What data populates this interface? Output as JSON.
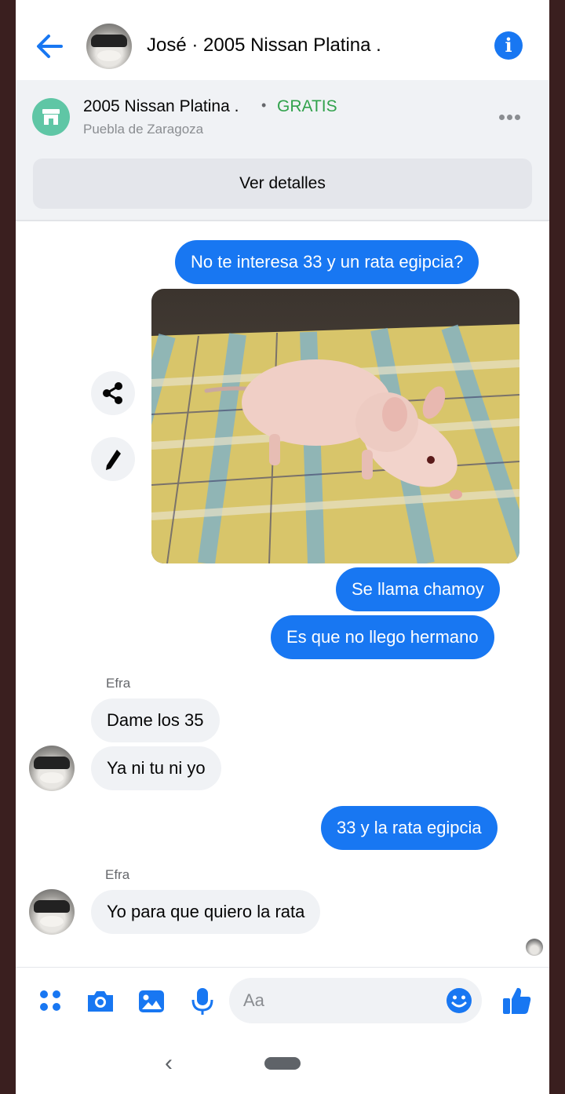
{
  "header": {
    "title": "José · 2005 Nissan Platina ."
  },
  "listing": {
    "title": "2005 Nissan Platina .",
    "separator": "•",
    "price": "GRATIS",
    "location": "Puebla de Zaragoza",
    "details_button": "Ver detalles"
  },
  "messages": [
    {
      "direction": "outgoing",
      "text": "No te interesa 33 y un rata egipcia?"
    },
    {
      "direction": "outgoing",
      "type": "photo"
    },
    {
      "direction": "outgoing",
      "text": "Se llama chamoy"
    },
    {
      "direction": "outgoing",
      "text": "Es que no llego hermano"
    },
    {
      "direction": "incoming",
      "sender": "Efra",
      "text": "Dame los 35"
    },
    {
      "direction": "incoming",
      "text": "Ya ni tu ni yo"
    },
    {
      "direction": "outgoing",
      "text": "33 y la rata egipcia"
    },
    {
      "direction": "incoming",
      "sender": "Efra",
      "text": "Yo para que quiero la rata"
    }
  ],
  "composer": {
    "placeholder": "Aa",
    "tools": [
      "apps-icon",
      "camera-icon",
      "gallery-icon",
      "microphone-icon"
    ],
    "accent_color": "#1877f2"
  },
  "navbar": {
    "back_glyph": "‹"
  }
}
